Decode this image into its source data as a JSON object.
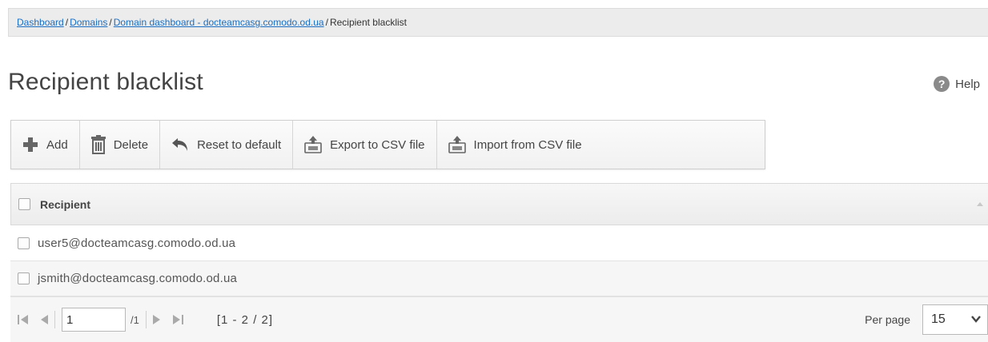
{
  "breadcrumb": {
    "items": [
      {
        "label": "Dashboard",
        "link": true
      },
      {
        "label": "Domains",
        "link": true
      },
      {
        "label": "Domain dashboard - docteamcasg.comodo.od.ua",
        "link": true
      },
      {
        "label": "Recipient blacklist",
        "link": false
      }
    ],
    "separator": "/"
  },
  "page": {
    "title": "Recipient blacklist",
    "help_label": "Help",
    "help_icon": "question-circle-icon"
  },
  "toolbar": {
    "add_label": "Add",
    "delete_label": "Delete",
    "reset_label": "Reset to default",
    "export_label": "Export to CSV file",
    "import_label": "Import from CSV file"
  },
  "grid": {
    "column_header": "Recipient",
    "rows": [
      {
        "recipient": "user5@docteamcasg.comodo.od.ua"
      },
      {
        "recipient": "jsmith@docteamcasg.comodo.od.ua"
      }
    ]
  },
  "pager": {
    "current_page": "1",
    "total_pages": "/1",
    "range": "[1 - 2 / 2]",
    "per_page_label": "Per page",
    "per_page_value": "15"
  },
  "colors": {
    "link": "#1a6fc4",
    "text": "#444444",
    "breadcrumb_bg": "#ececec"
  }
}
